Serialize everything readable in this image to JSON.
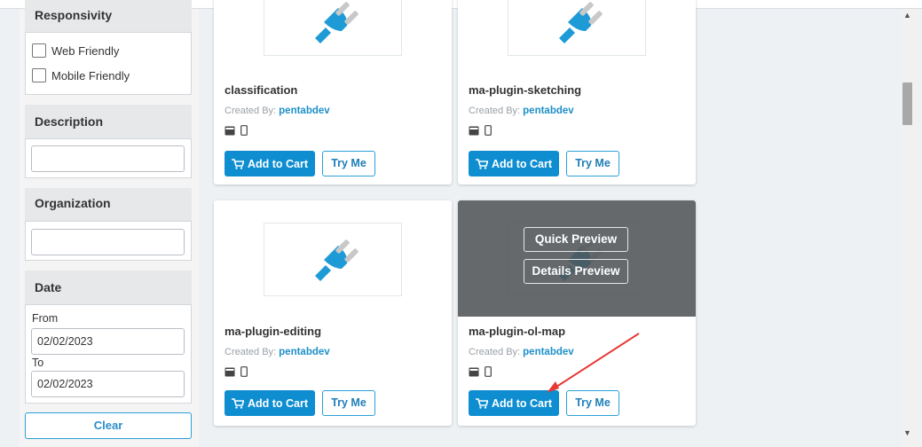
{
  "filters": {
    "responsivity": {
      "title": "Responsivity",
      "options": [
        "Web Friendly",
        "Mobile Friendly"
      ]
    },
    "description": {
      "title": "Description",
      "value": ""
    },
    "organization": {
      "title": "Organization",
      "value": ""
    },
    "date": {
      "title": "Date",
      "from_label": "From",
      "from_value": "02/02/2023",
      "to_label": "To",
      "to_value": "02/02/2023"
    },
    "clear_label": "Clear"
  },
  "cards": [
    {
      "title": "classification",
      "created_by_label": "Created By:",
      "author": "pentabdev",
      "add_label": "Add to Cart",
      "try_label": "Try Me"
    },
    {
      "title": "ma-plugin-sketching",
      "created_by_label": "Created By:",
      "author": "pentabdev",
      "add_label": "Add to Cart",
      "try_label": "Try Me"
    },
    {
      "title": "ma-plugin-editing",
      "created_by_label": "Created By:",
      "author": "pentabdev",
      "add_label": "Add to Cart",
      "try_label": "Try Me"
    },
    {
      "title": "ma-plugin-ol-map",
      "created_by_label": "Created By:",
      "author": "pentabdev",
      "add_label": "Add to Cart",
      "try_label": "Try Me",
      "overlay": {
        "quick_preview": "Quick Preview",
        "details_preview": "Details Preview"
      }
    }
  ],
  "colors": {
    "accent": "#0e8ed1",
    "plug": "#1e9ad6",
    "annotation_arrow": "#e53935"
  },
  "icons": [
    "plug-icon",
    "cart-icon",
    "desktop-icon",
    "mobile-icon",
    "scroll-up-icon",
    "scroll-down-icon"
  ]
}
